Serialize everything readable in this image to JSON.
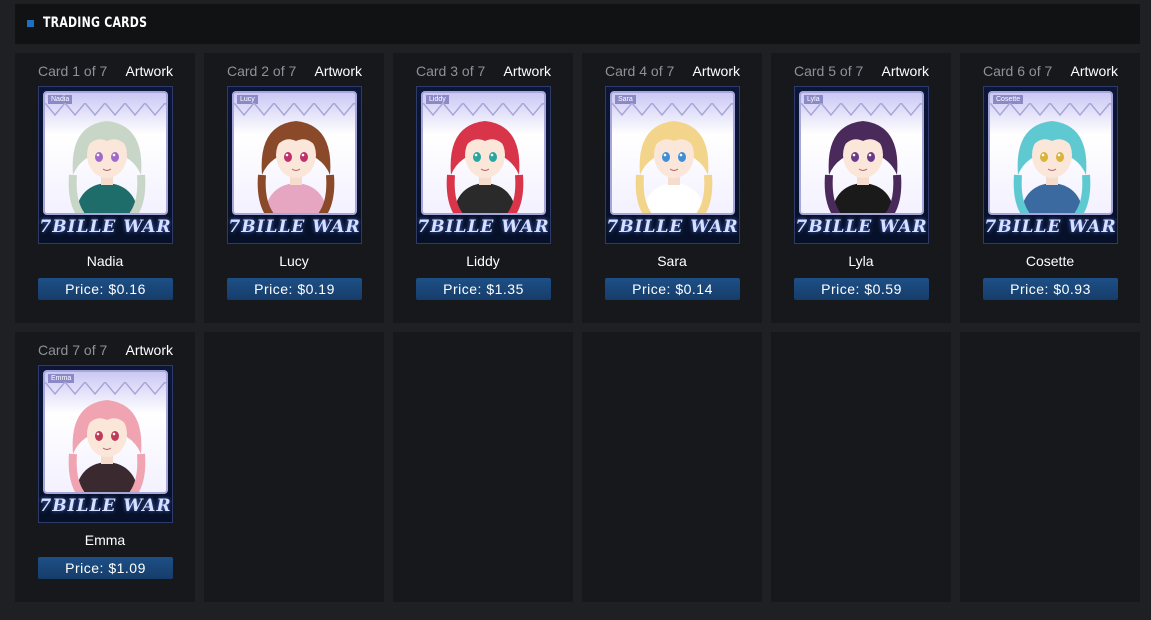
{
  "header": {
    "title": "TRADING CARDS"
  },
  "common": {
    "artwork_label": "Artwork",
    "logo_text": "7BILLE WAR",
    "price_prefix": "Price: "
  },
  "cards": [
    {
      "count": "Card 1 of 7",
      "name": "Nadia",
      "price": "Price: $0.16",
      "hair": "#c8d6c8",
      "outfit": "#1f6d6a",
      "eyes": "#a06acb"
    },
    {
      "count": "Card 2 of 7",
      "name": "Lucy",
      "price": "Price: $0.19",
      "hair": "#8a4a2a",
      "outfit": "#e6a6c2",
      "eyes": "#c0306b"
    },
    {
      "count": "Card 3 of 7",
      "name": "Liddy",
      "price": "Price: $1.35",
      "hair": "#d8354a",
      "outfit": "#2a2a2a",
      "eyes": "#2aa6a0"
    },
    {
      "count": "Card 4 of 7",
      "name": "Sara",
      "price": "Price: $0.14",
      "hair": "#f2d48a",
      "outfit": "#ffffff",
      "eyes": "#3f8fd8"
    },
    {
      "count": "Card 5 of 7",
      "name": "Lyla",
      "price": "Price: $0.59",
      "hair": "#4a2a5a",
      "outfit": "#1a1a1a",
      "eyes": "#6a3a8a"
    },
    {
      "count": "Card 6 of 7",
      "name": "Cosette",
      "price": "Price: $0.93",
      "hair": "#5fc9d2",
      "outfit": "#3a6aa0",
      "eyes": "#d8b43a"
    },
    {
      "count": "Card 7 of 7",
      "name": "Emma",
      "price": "Price: $1.09",
      "hair": "#f0a3b0",
      "outfit": "#3a2a30",
      "eyes": "#c03a5a"
    }
  ],
  "empty_slots": 5
}
